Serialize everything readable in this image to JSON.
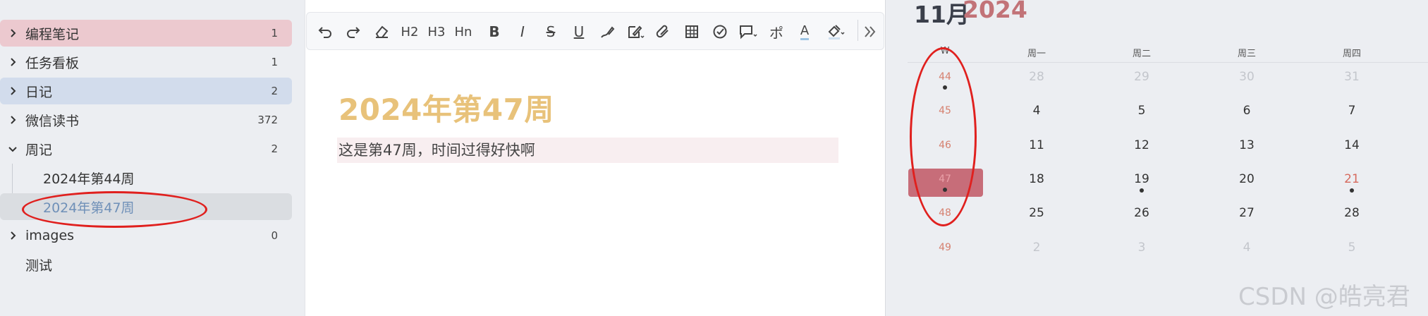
{
  "sidebar": {
    "items": [
      {
        "label": "编程笔记",
        "count": "1",
        "expanded": false,
        "bg": "#ecc9cf"
      },
      {
        "label": "任务看板",
        "count": "1",
        "expanded": false,
        "bg": ""
      },
      {
        "label": "日记",
        "count": "2",
        "expanded": false,
        "bg": "#d2dcec"
      },
      {
        "label": "微信读书",
        "count": "372",
        "expanded": false,
        "bg": ""
      },
      {
        "label": "周记",
        "count": "2",
        "expanded": true,
        "bg": ""
      },
      {
        "label": "2024年第44周",
        "count": "",
        "child": true,
        "bg": ""
      },
      {
        "label": "2024年第47周",
        "count": "",
        "child": true,
        "selected": true,
        "bg": "#dadde1"
      },
      {
        "label": "images",
        "count": "0",
        "expanded": false,
        "bg": ""
      },
      {
        "label": "测试",
        "count": "",
        "bg": ""
      }
    ]
  },
  "toolbar": {
    "buttons": [
      {
        "name": "undo-icon"
      },
      {
        "name": "redo-icon"
      },
      {
        "name": "eraser-icon"
      },
      {
        "name": "h2-button",
        "text": "H2"
      },
      {
        "name": "h3-button",
        "text": "H3"
      },
      {
        "name": "hn-button",
        "text": "Hn"
      },
      {
        "name": "bold-button",
        "text": "B"
      },
      {
        "name": "italic-button",
        "text": "I"
      },
      {
        "name": "strikethrough-button",
        "text": "S"
      },
      {
        "name": "underline-button",
        "text": "U"
      },
      {
        "name": "highlight-pen-icon"
      },
      {
        "name": "edit-pen-icon"
      },
      {
        "name": "attachment-icon"
      },
      {
        "name": "table-icon"
      },
      {
        "name": "checkbox-icon"
      },
      {
        "name": "comment-icon"
      },
      {
        "name": "ruby-button",
        "text": "ポ"
      },
      {
        "name": "font-color-button",
        "text": "A"
      },
      {
        "name": "fill-color-icon"
      },
      {
        "name": "more-icon"
      }
    ]
  },
  "document": {
    "title": "2024年第47周",
    "line": "这是第47周，时间过得好快啊"
  },
  "calendar": {
    "month": "11月",
    "year": "2024",
    "week_header": "W",
    "weekdays": [
      "周一",
      "周二",
      "周三",
      "周四"
    ],
    "weeks": [
      {
        "week": "44",
        "days": [
          "28",
          "29",
          "30",
          "31"
        ],
        "dim": [
          true,
          true,
          true,
          true
        ],
        "dotweek": true,
        "dots": [
          false,
          false,
          false,
          false
        ]
      },
      {
        "week": "45",
        "days": [
          "4",
          "5",
          "6",
          "7"
        ],
        "dim": [
          false,
          false,
          false,
          false
        ],
        "dotweek": false,
        "dots": [
          false,
          false,
          false,
          false
        ]
      },
      {
        "week": "46",
        "days": [
          "11",
          "12",
          "13",
          "14"
        ],
        "dim": [
          false,
          false,
          false,
          false
        ],
        "dotweek": false,
        "dots": [
          false,
          false,
          false,
          false
        ]
      },
      {
        "week": "47",
        "days": [
          "18",
          "19",
          "20",
          "21"
        ],
        "dim": [
          false,
          false,
          false,
          false
        ],
        "dotweek": true,
        "current": true,
        "dots": [
          false,
          true,
          false,
          true
        ],
        "weekend_idx": 3
      },
      {
        "week": "48",
        "days": [
          "25",
          "26",
          "27",
          "28"
        ],
        "dim": [
          false,
          false,
          false,
          false
        ],
        "dotweek": false,
        "dots": [
          false,
          false,
          false,
          false
        ]
      },
      {
        "week": "49",
        "days": [
          "2",
          "3",
          "4",
          "5"
        ],
        "dim": [
          true,
          true,
          true,
          true
        ],
        "dotweek": false,
        "dots": [
          false,
          false,
          false,
          false
        ]
      }
    ]
  },
  "watermark": "CSDN @皓亮君",
  "colors": {
    "accent": "#c76d79",
    "title": "#e8c27a",
    "annotation": "#e0201e"
  }
}
